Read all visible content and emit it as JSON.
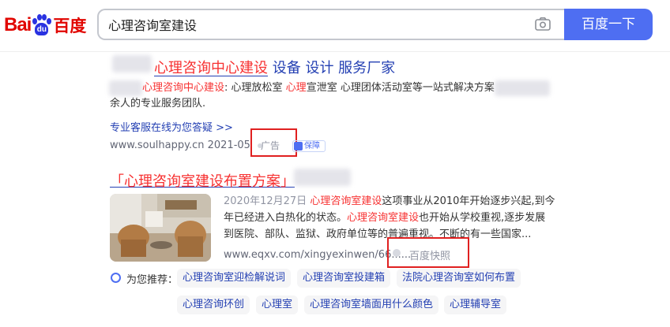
{
  "header": {
    "logo_bai": "Bai",
    "logo_paw_text": "du",
    "logo_cn": "百度",
    "search_value": "心理咨询室建设",
    "search_button": "百度一下"
  },
  "result1": {
    "title_red": "心理咨询中心建设",
    "title_rest": " 设备 设计 服务厂家",
    "desc_red1": "心理咨询中心建设",
    "desc_mid1": ": 心理放松室 ",
    "desc_red2": "心理",
    "desc_mid2": "宣泄室 心理团体活动室等一站式解决方案",
    "desc_line2": "余人的专业服务团队.",
    "consult_link": "专业客服在线为您答疑 >>",
    "url": "www.soulhappy.cn",
    "date": "2021-05",
    "ad_label": "广告",
    "guarantee": "保障"
  },
  "result2": {
    "title": "「心理咨询室建设布置方案」",
    "date": "2020年12月27日",
    "line1_red": "心理咨询室建设",
    "line1_rest": "这项事业从2010年开始逐步兴起,到今",
    "line2_a": "年已经进入白热化的状态。",
    "line2_red": "心理咨询室建设",
    "line2_b": "也开始从学校重视,逐步发展",
    "line3": "到医院、部队、监狱、政府单位等的普遍重视。不断的有一些国家...",
    "url": "www.eqxv.com/xingyexinwen/66......",
    "snapshot": "百度快照"
  },
  "recommend": {
    "label": "为您推荐：",
    "tags": [
      "心理咨询室迎检解说词",
      "心理咨询室投建箱",
      "法院心理咨询室如何布置",
      "心理咨询环创",
      "心理室",
      "心理咨询室墙面用什么颜色",
      "心理辅导室"
    ]
  },
  "colors": {
    "brand_blue": "#4e6ef2",
    "link_blue": "#2440b3",
    "highlight_red": "#f73131",
    "annotation_red": "#e02020"
  }
}
